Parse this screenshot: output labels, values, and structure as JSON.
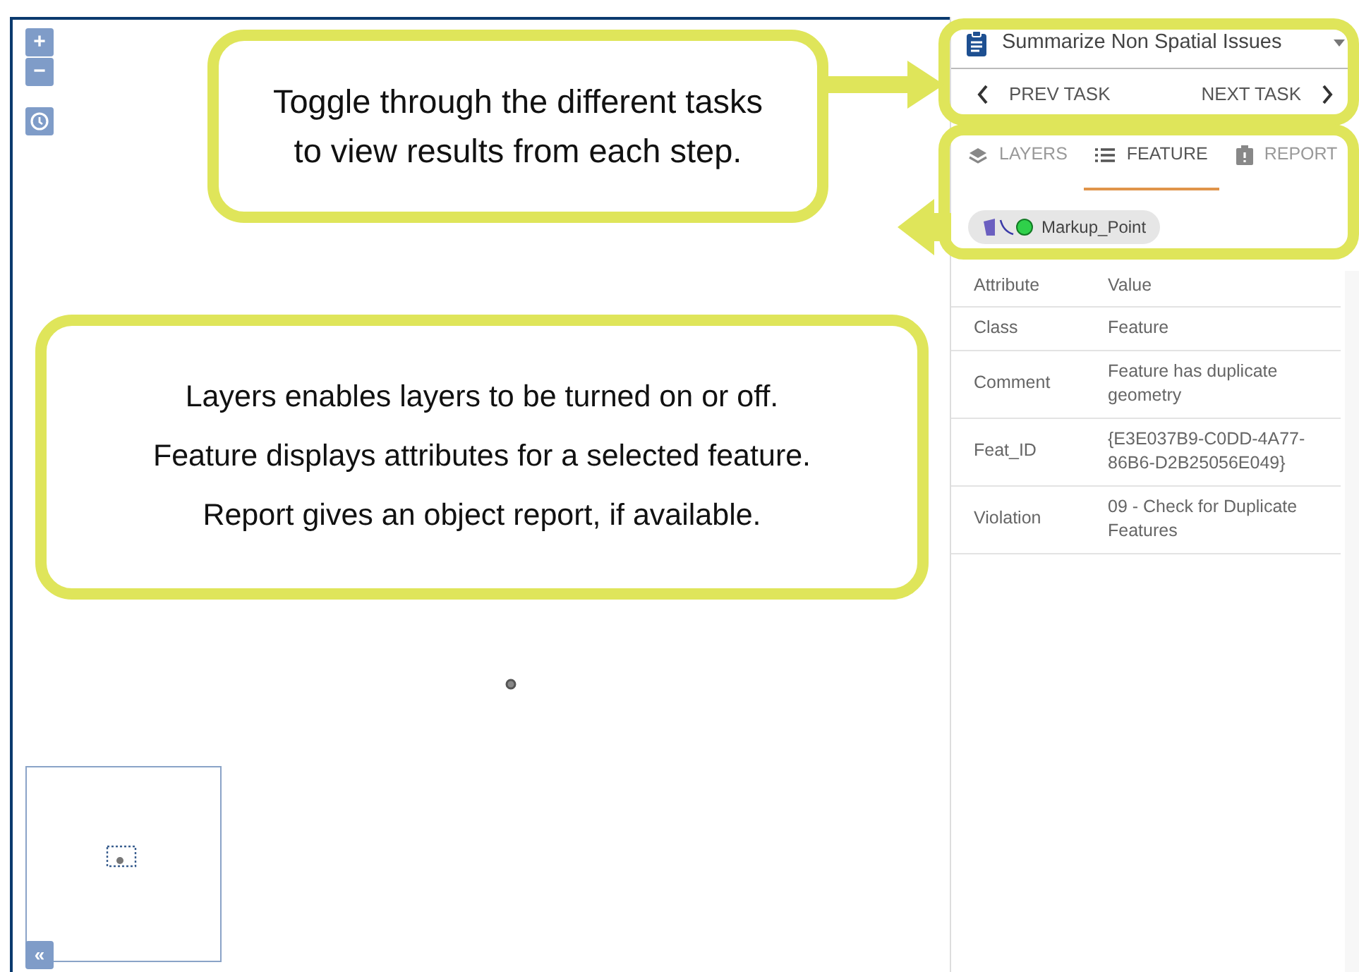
{
  "map": {
    "zoom_in": "+",
    "zoom_out": "−",
    "collapse": "«"
  },
  "callouts": [
    {
      "kind": "tasks",
      "lines": [
        "Toggle through the different tasks",
        "to view results from each step."
      ]
    },
    {
      "kind": "tabs",
      "lines": [
        "Layers enables layers to be turned on or off.",
        "Feature displays attributes for a selected feature.",
        "Report gives an object report, if available."
      ]
    }
  ],
  "task": {
    "title": "Summarize Non Spatial Issues",
    "prev": "PREV TASK",
    "next": "NEXT TASK"
  },
  "tabs": [
    {
      "label": "LAYERS",
      "kind": "layers",
      "selected": false
    },
    {
      "label": "FEATURE",
      "kind": "list",
      "selected": true
    },
    {
      "label": "REPORT",
      "kind": "report",
      "selected": false
    }
  ],
  "chip": {
    "label": "Markup_Point"
  },
  "table": {
    "columns": [
      "Attribute",
      "Value"
    ],
    "rows": [
      [
        "Class",
        "Feature"
      ],
      [
        "Comment",
        "Feature has duplicate geometry"
      ],
      [
        "Feat_ID",
        "{E3E037B9-C0DD-4A77-86B6-D2B25056E049}"
      ],
      [
        "Violation",
        "09 - Check for Duplicate Features"
      ]
    ]
  }
}
